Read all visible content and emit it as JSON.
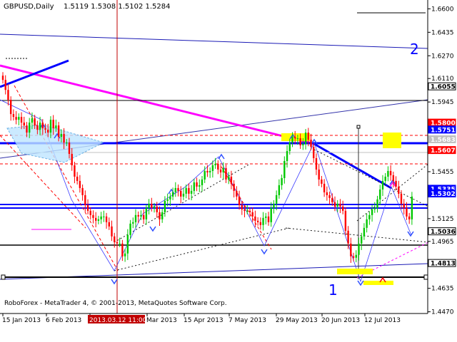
{
  "header": {
    "symbol_tf": "GBPUSD,Daily",
    "ohlc": "1.5119 1.5308 1.5102 1.5284"
  },
  "footer": {
    "copyright": "RoboForex - MetaTrader 4, © 2001-2013, MetaQuotes Software Corp."
  },
  "wave_labels": [
    "1",
    "2"
  ],
  "colors": {
    "accent_blue": "#0000ff",
    "magenta": "#ff00ff",
    "red": "#ff0000",
    "highlight_yellow": "#ffff00",
    "bull": "#00c800",
    "bear": "#ff0000",
    "crosshair": "#c00000"
  },
  "chart_data": {
    "type": "candlestick",
    "symbol": "GBPUSD",
    "timeframe": "Daily",
    "ylim": [
      1.4458,
      1.6662
    ],
    "price_ticks": [
      "1.6600",
      "1.6435",
      "1.6270",
      "1.6110",
      "1.5945",
      "1.5780",
      "1.5615",
      "1.5455",
      "1.5290",
      "1.5125",
      "1.4965",
      "1.4800",
      "1.4635",
      "1.4470"
    ],
    "highlighted_prices": [
      {
        "label": "1.6055",
        "color": "#000000"
      },
      {
        "label": "1.5800",
        "color": "#ff0000"
      },
      {
        "label": "1.5751",
        "color": "#0000ff"
      },
      {
        "label": "1.5683",
        "color": "#c0c0c0"
      },
      {
        "label": "1.5607",
        "color": "#ff0000"
      },
      {
        "label": "1.5335",
        "color": "#0000ff"
      },
      {
        "label": "1.5302",
        "color": "#0000ff"
      },
      {
        "label": "1.5036",
        "color": "#000000"
      },
      {
        "label": "1.4813",
        "color": "#000000"
      }
    ],
    "x_labels": [
      "15 Jan 2013",
      "6 Feb 2013",
      "2013.03.12 11:00",
      "Mar 2013",
      "15 Apr 2013",
      "7 May 2013",
      "29 May 2013",
      "20 Jun 2013",
      "12 Jul 2013"
    ],
    "crosshair_label": "2013.03.12 11:00",
    "close_series": [
      1.61,
      1.603,
      1.596,
      1.586,
      1.584,
      1.582,
      1.584,
      1.58,
      1.578,
      1.573,
      1.58,
      1.583,
      1.578,
      1.575,
      1.58,
      1.576,
      1.575,
      1.573,
      1.582,
      1.576,
      1.578,
      1.57,
      1.572,
      1.566,
      1.566,
      1.558,
      1.55,
      1.542,
      1.539,
      1.534,
      1.529,
      1.522,
      1.518,
      1.515,
      1.513,
      1.511,
      1.512,
      1.514,
      1.514,
      1.51,
      1.507,
      1.5,
      1.496,
      1.495,
      1.495,
      1.486,
      1.488,
      1.501,
      1.509,
      1.51,
      1.515,
      1.514,
      1.515,
      1.512,
      1.52,
      1.523,
      1.52,
      1.521,
      1.517,
      1.512,
      1.517,
      1.525,
      1.526,
      1.528,
      1.531,
      1.534,
      1.532,
      1.528,
      1.53,
      1.534,
      1.53,
      1.532,
      1.538,
      1.535,
      1.536,
      1.54,
      1.546,
      1.545,
      1.546,
      1.55,
      1.551,
      1.547,
      1.545,
      1.548,
      1.54,
      1.542,
      1.537,
      1.532,
      1.528,
      1.522,
      1.519,
      1.518,
      1.518,
      1.517,
      1.514,
      1.511,
      1.51,
      1.508,
      1.513,
      1.514,
      1.51,
      1.52,
      1.523,
      1.529,
      1.536,
      1.541,
      1.553,
      1.56,
      1.566,
      1.57,
      1.569,
      1.569,
      1.564,
      1.565,
      1.573,
      1.568,
      1.563,
      1.555,
      1.547,
      1.54,
      1.537,
      1.531,
      1.529,
      1.527,
      1.524,
      1.521,
      1.523,
      1.521,
      1.518,
      1.504,
      1.495,
      1.486,
      1.485,
      1.487,
      1.495,
      1.5,
      1.506,
      1.512,
      1.515,
      1.519,
      1.52,
      1.526,
      1.533,
      1.539,
      1.542,
      1.546,
      1.543,
      1.539,
      1.535,
      1.53,
      1.523,
      1.52,
      1.514,
      1.512,
      1.528
    ]
  }
}
